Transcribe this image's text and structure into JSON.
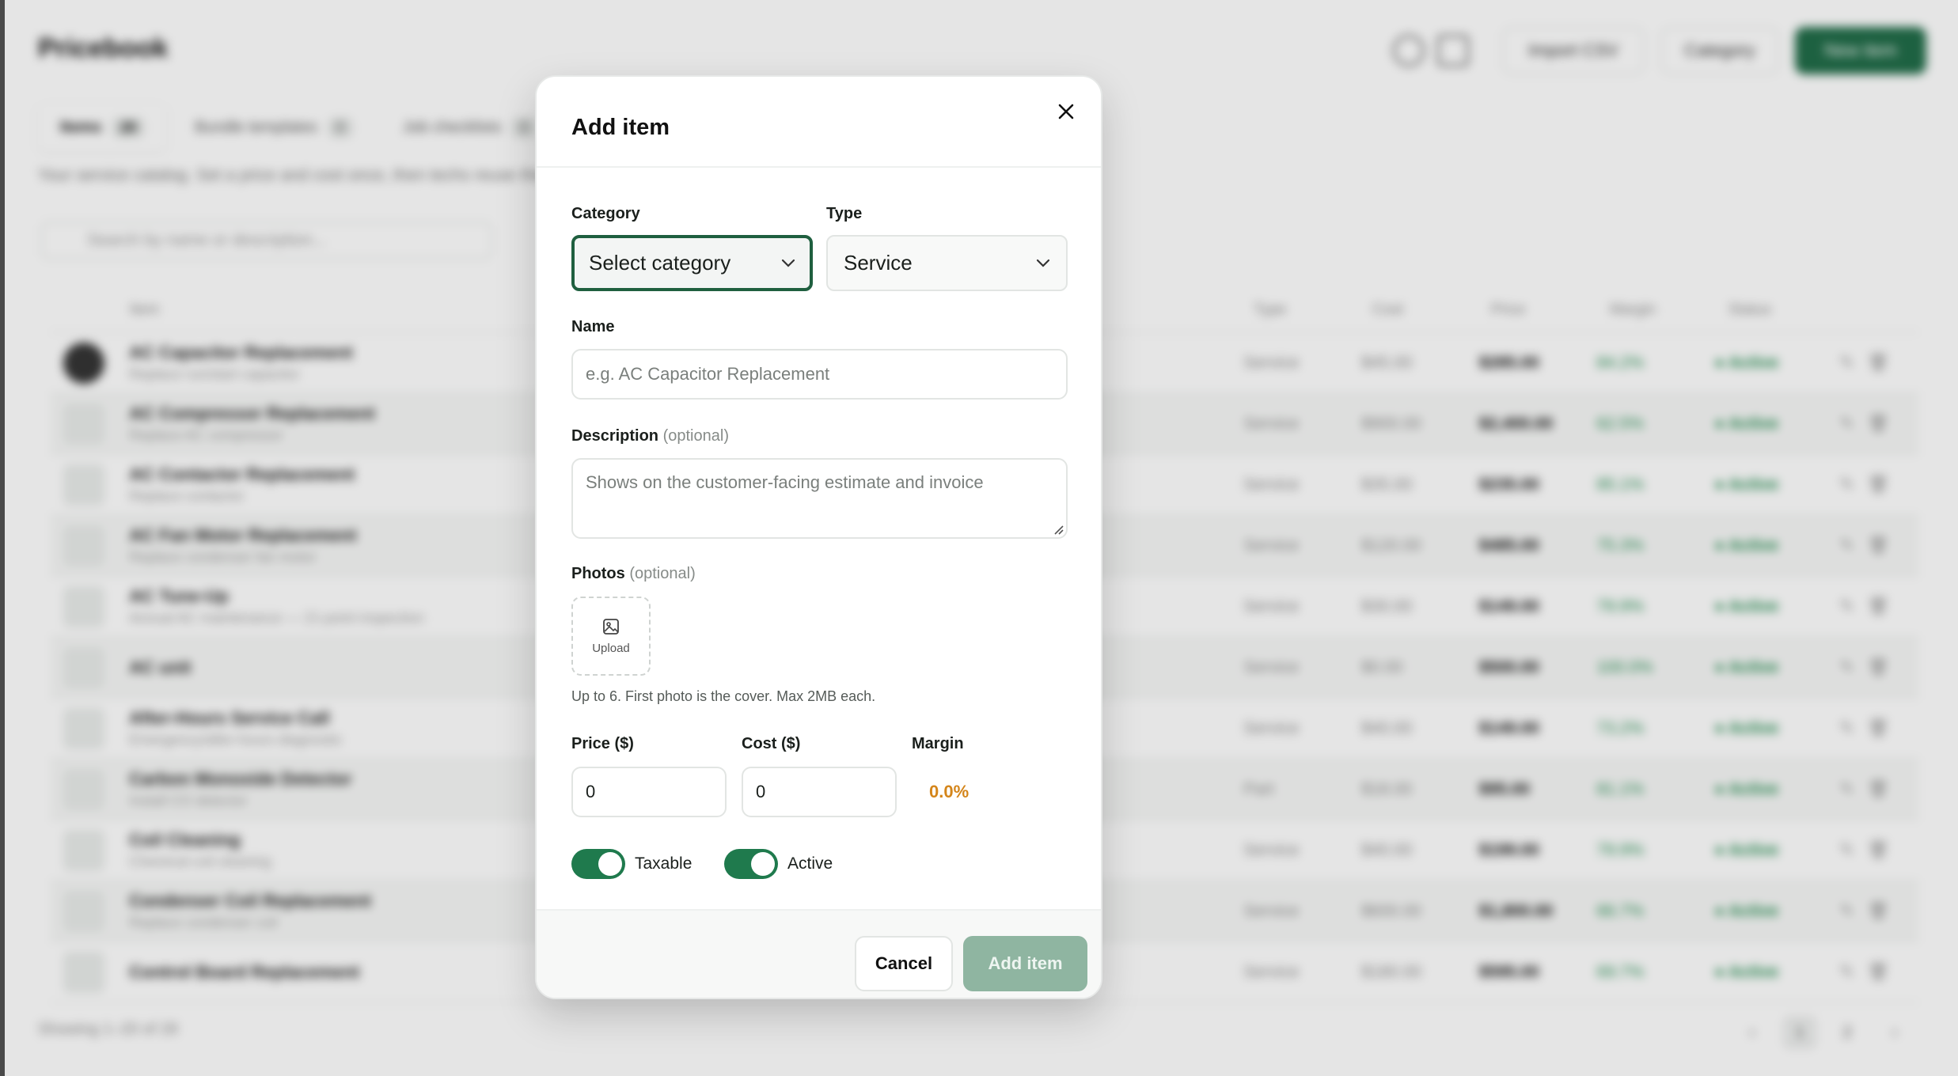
{
  "background": {
    "title": "Pricebook",
    "header_buttons": {
      "import": "Import CSV",
      "category": "Category",
      "new_item": "New item"
    },
    "tabs": [
      {
        "label": "Items",
        "count": "20"
      },
      {
        "label": "Bundle templates",
        "count": "0"
      },
      {
        "label": "Job checklists",
        "count": "0"
      }
    ],
    "description": "Your service catalog. Set a price and cost once, then techs reuse them",
    "search_placeholder": "Search by name or description...",
    "columns": {
      "item": "Item",
      "type": "Type",
      "cost": "Cost",
      "price": "Price",
      "margin": "Margin",
      "status": "Status"
    },
    "rows": [
      {
        "name": "AC Capacitor Replacement",
        "sub": "Replace run/start capacitor",
        "type": "Service",
        "cost": "$45.00",
        "price": "$285.00",
        "margin": "84.2%",
        "status": "Active"
      },
      {
        "name": "AC Compressor Replacement",
        "sub": "Replace AC compressor",
        "type": "Service",
        "cost": "$900.00",
        "price": "$2,400.00",
        "margin": "62.5%",
        "status": "Active"
      },
      {
        "name": "AC Contactor Replacement",
        "sub": "Replace contactor",
        "type": "Service",
        "cost": "$35.00",
        "price": "$235.00",
        "margin": "85.1%",
        "status": "Active"
      },
      {
        "name": "AC Fan Motor Replacement",
        "sub": "Replace condenser fan motor",
        "type": "Service",
        "cost": "$120.00",
        "price": "$485.00",
        "margin": "75.3%",
        "status": "Active"
      },
      {
        "name": "AC Tune-Up",
        "sub": "Annual AC maintenance — 21-point inspection",
        "type": "Service",
        "cost": "$30.00",
        "price": "$149.00",
        "margin": "79.9%",
        "status": "Active"
      },
      {
        "name": "AC unit",
        "sub": "",
        "type": "Service",
        "cost": "$0.00",
        "price": "$500.00",
        "margin": "100.0%",
        "status": "Active"
      },
      {
        "name": "After-Hours Service Call",
        "sub": "Emergency/after-hours diagnostic",
        "type": "Service",
        "cost": "$40.00",
        "price": "$149.00",
        "margin": "73.2%",
        "status": "Active"
      },
      {
        "name": "Carbon Monoxide Detector",
        "sub": "Install CO detector",
        "type": "Part",
        "cost": "$18.00",
        "price": "$95.00",
        "margin": "81.1%",
        "status": "Active"
      },
      {
        "name": "Coil Cleaning",
        "sub": "Chemical coil cleaning",
        "type": "Service",
        "cost": "$40.00",
        "price": "$199.00",
        "margin": "79.9%",
        "status": "Active"
      },
      {
        "name": "Condenser Coil Replacement",
        "sub": "Replace condenser coil",
        "type": "Service",
        "cost": "$600.00",
        "price": "$1,800.00",
        "margin": "66.7%",
        "status": "Active"
      },
      {
        "name": "Control Board Replacement",
        "sub": "",
        "type": "Service",
        "cost": "$180.00",
        "price": "$595.00",
        "margin": "69.7%",
        "status": "Active"
      }
    ],
    "footer": "Showing 1–20 of 28",
    "pages": [
      "1",
      "2"
    ]
  },
  "modal": {
    "title": "Add item",
    "category_label": "Category",
    "category_value": "Select category",
    "type_label": "Type",
    "type_value": "Service",
    "name_label": "Name",
    "name_placeholder": "e.g. AC Capacitor Replacement",
    "description_label": "Description",
    "optional": "(optional)",
    "description_placeholder": "Shows on the customer-facing estimate and invoice",
    "photos_label": "Photos",
    "upload_label": "Upload",
    "photos_hint": "Up to 6. First photo is the cover. Max 2MB each.",
    "price_label": "Price ($)",
    "price_value": "0",
    "cost_label": "Cost ($)",
    "cost_value": "0",
    "margin_label": "Margin",
    "margin_value": "0.0%",
    "taxable_label": "Taxable",
    "taxable_on": true,
    "active_label": "Active",
    "active_on": true,
    "cancel_label": "Cancel",
    "submit_label": "Add item"
  },
  "colors": {
    "accent": "#1f7a4d",
    "margin_warning": "#d4851a",
    "submit_disabled": "#8fb5a1"
  }
}
